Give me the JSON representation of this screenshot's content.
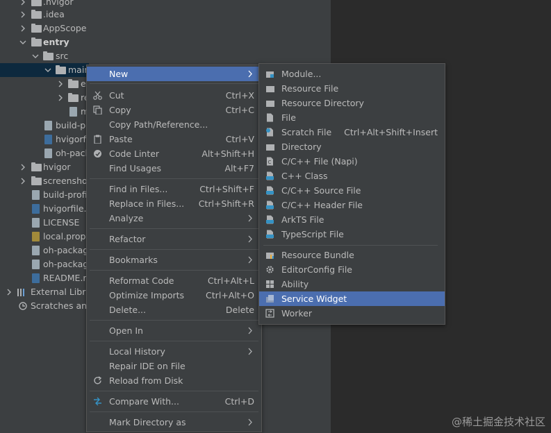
{
  "tree": {
    "items": [
      {
        "label": ".hvigor"
      },
      {
        "label": ".idea"
      },
      {
        "label": "AppScope"
      },
      {
        "label": "entry"
      },
      {
        "label": "src"
      },
      {
        "label": "main"
      },
      {
        "label": "e"
      },
      {
        "label": "re"
      },
      {
        "label": "m"
      },
      {
        "label": "build-p"
      },
      {
        "label": "hvigorfi"
      },
      {
        "label": "oh-pack"
      },
      {
        "label": "hvigor"
      },
      {
        "label": "screenshot"
      },
      {
        "label": "build-profi"
      },
      {
        "label": "hvigorfile.t"
      },
      {
        "label": "LICENSE"
      },
      {
        "label": "local.prope"
      },
      {
        "label": "oh-packag"
      },
      {
        "label": "oh-packag"
      },
      {
        "label": "README.m"
      },
      {
        "label": "External Libra"
      },
      {
        "label": "Scratches and"
      }
    ]
  },
  "context_menu": {
    "items": [
      {
        "label": "New",
        "shortcut": ""
      },
      {
        "label": "Cut",
        "shortcut": "Ctrl+X"
      },
      {
        "label": "Copy",
        "shortcut": "Ctrl+C"
      },
      {
        "label": "Copy Path/Reference...",
        "shortcut": ""
      },
      {
        "label": "Paste",
        "shortcut": "Ctrl+V"
      },
      {
        "label": "Code Linter",
        "shortcut": "Alt+Shift+H"
      },
      {
        "label": "Find Usages",
        "shortcut": "Alt+F7"
      },
      {
        "label": "Find in Files...",
        "shortcut": "Ctrl+Shift+F"
      },
      {
        "label": "Replace in Files...",
        "shortcut": "Ctrl+Shift+R"
      },
      {
        "label": "Analyze",
        "shortcut": ""
      },
      {
        "label": "Refactor",
        "shortcut": ""
      },
      {
        "label": "Bookmarks",
        "shortcut": ""
      },
      {
        "label": "Reformat Code",
        "shortcut": "Ctrl+Alt+L"
      },
      {
        "label": "Optimize Imports",
        "shortcut": "Ctrl+Alt+O"
      },
      {
        "label": "Delete...",
        "shortcut": "Delete"
      },
      {
        "label": "Open In",
        "shortcut": ""
      },
      {
        "label": "Local History",
        "shortcut": ""
      },
      {
        "label": "Repair IDE on File",
        "shortcut": ""
      },
      {
        "label": "Reload from Disk",
        "shortcut": ""
      },
      {
        "label": "Compare With...",
        "shortcut": "Ctrl+D"
      },
      {
        "label": "Mark Directory as",
        "shortcut": ""
      }
    ]
  },
  "new_submenu": {
    "items": [
      {
        "label": "Module...",
        "shortcut": ""
      },
      {
        "label": "Resource File",
        "shortcut": ""
      },
      {
        "label": "Resource Directory",
        "shortcut": ""
      },
      {
        "label": "File",
        "shortcut": ""
      },
      {
        "label": "Scratch File",
        "shortcut": "Ctrl+Alt+Shift+Insert"
      },
      {
        "label": "Directory",
        "shortcut": ""
      },
      {
        "label": "C/C++ File (Napi)",
        "shortcut": ""
      },
      {
        "label": "C++ Class",
        "shortcut": ""
      },
      {
        "label": "C/C++ Source File",
        "shortcut": ""
      },
      {
        "label": "C/C++ Header File",
        "shortcut": ""
      },
      {
        "label": "ArkTS File",
        "shortcut": ""
      },
      {
        "label": "TypeScript File",
        "shortcut": ""
      },
      {
        "label": "Resource Bundle",
        "shortcut": ""
      },
      {
        "label": "EditorConfig File",
        "shortcut": ""
      },
      {
        "label": "Ability",
        "shortcut": ""
      },
      {
        "label": "Service Widget",
        "shortcut": ""
      },
      {
        "label": "Worker",
        "shortcut": ""
      }
    ]
  },
  "watermark": "@稀土掘金技术社区",
  "colors": {
    "highlight": "#4b6eaf",
    "panel": "#3c3f41",
    "editor": "#2b2b2b",
    "selection_row": "#0d293e"
  }
}
